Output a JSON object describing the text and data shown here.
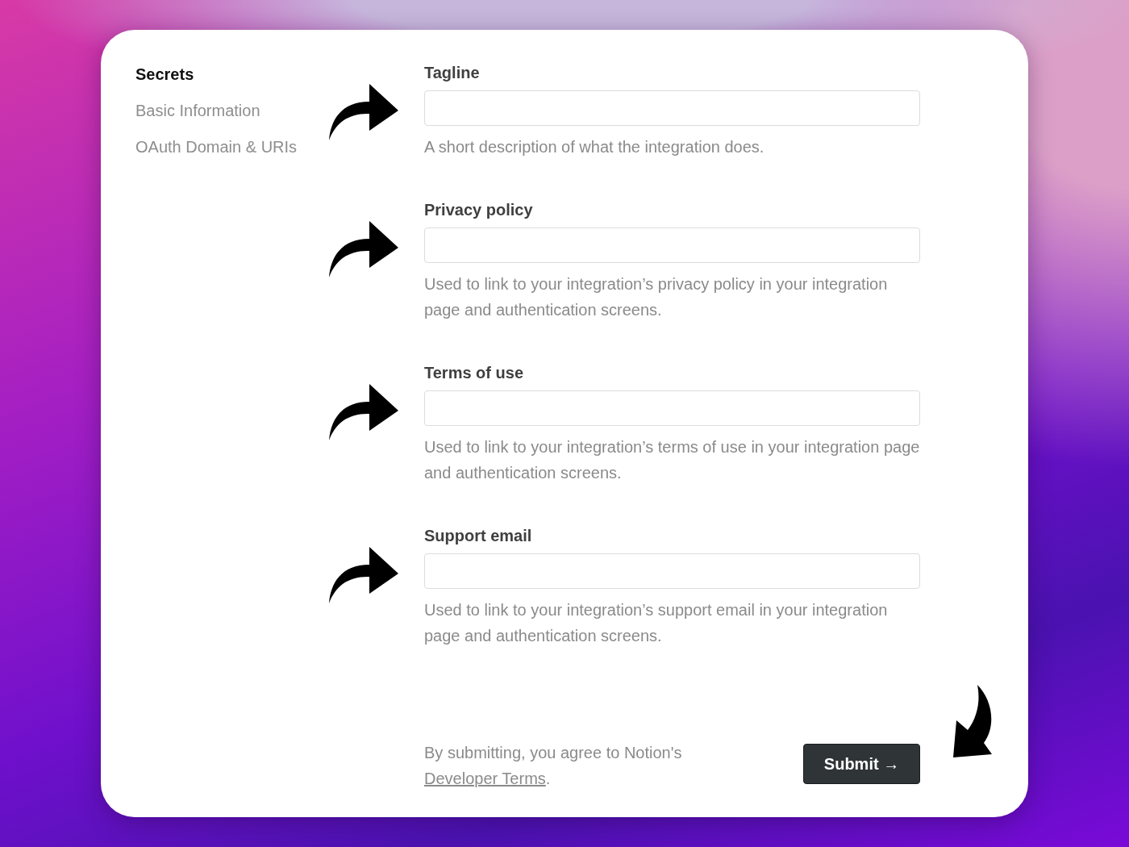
{
  "sidebar": {
    "items": [
      {
        "label": "Secrets",
        "selected": true
      },
      {
        "label": "Basic Information",
        "selected": false
      },
      {
        "label": "OAuth Domain & URIs",
        "selected": false
      }
    ]
  },
  "fields": [
    {
      "label": "Tagline",
      "help": "A short description of what the integration does."
    },
    {
      "label": "Privacy policy",
      "help": "Used to link to your integration’s privacy policy in your integration page and authentication screens."
    },
    {
      "label": "Terms of use",
      "help": "Used to link to your integration’s terms of use in your integration page and authentication screens."
    },
    {
      "label": "Support email",
      "help": "Used to link to your integration’s support email in your integration page and authentication screens."
    }
  ],
  "footer": {
    "text": "By submitting, you agree to Notion's",
    "link": "Developer Terms",
    "after": ".",
    "button": "Submit →"
  }
}
